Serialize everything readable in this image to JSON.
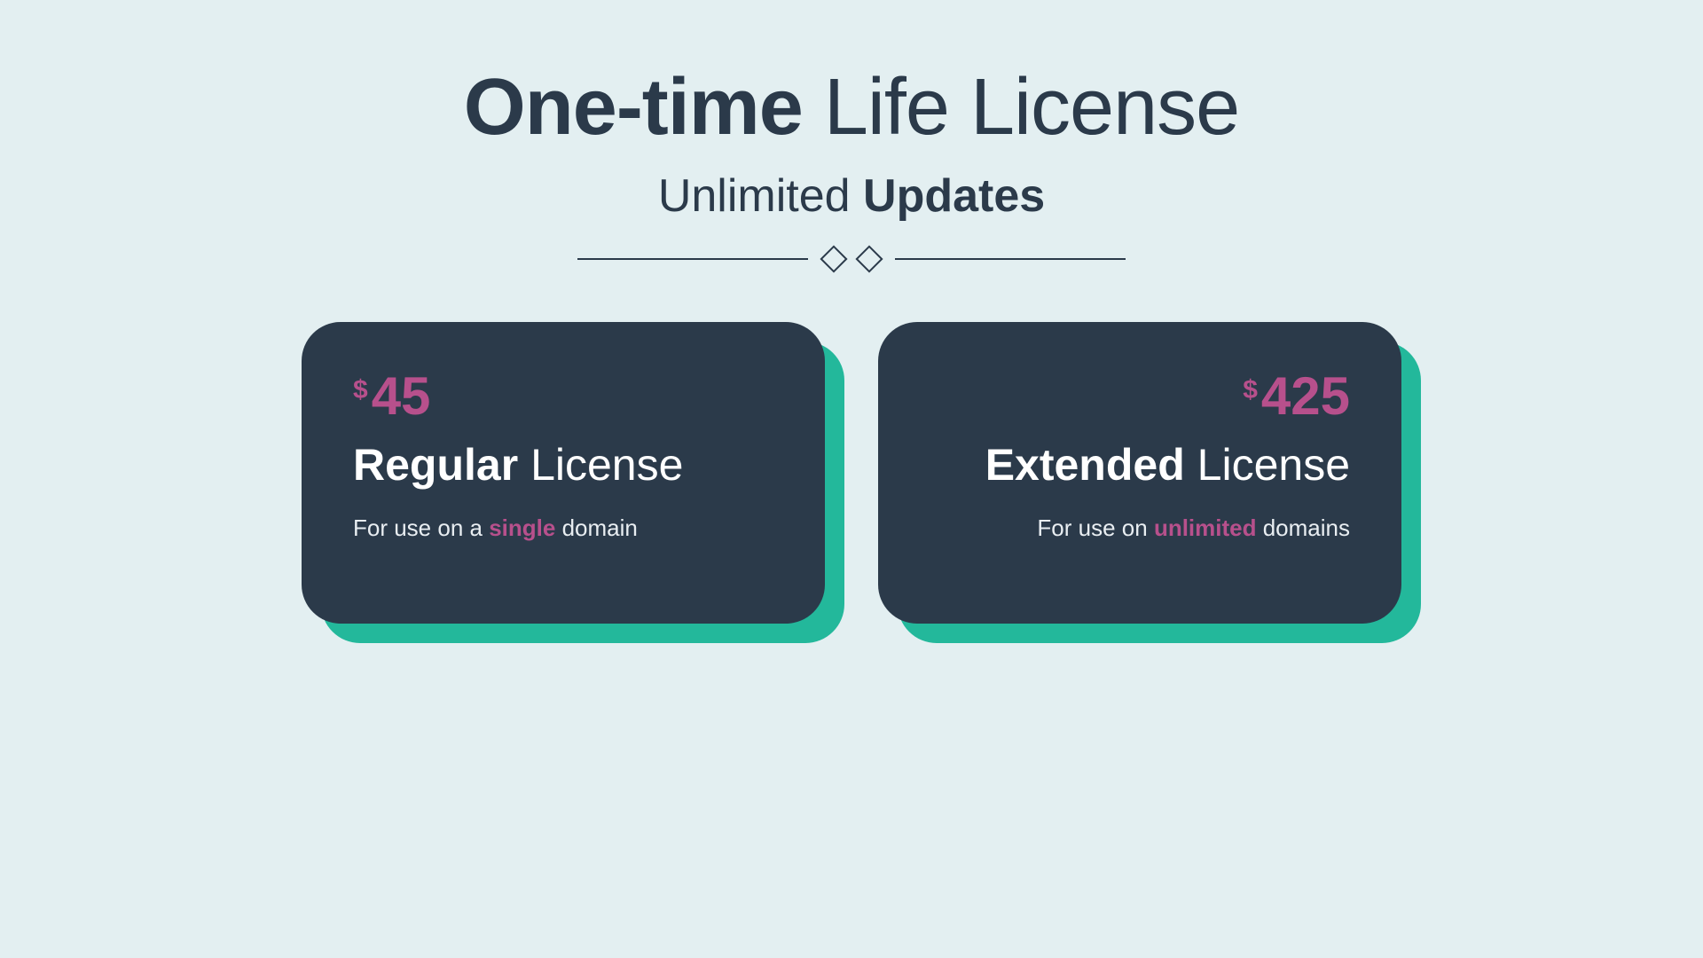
{
  "colors": {
    "background": "#e3eff1",
    "text_dark": "#2b3a4a",
    "card_bg": "#2b3a4a",
    "accent_teal": "#23b89b",
    "accent_pink": "#b7508c"
  },
  "headline": {
    "bold": "One-time",
    "light": "Life License"
  },
  "subhead": {
    "light": "Unlimited",
    "bold": "Updates"
  },
  "cards": [
    {
      "currency": "$",
      "price": "45",
      "title_bold": "Regular",
      "title_light": "License",
      "desc_pre": "For use on a ",
      "desc_hl": "single",
      "desc_post": " domain"
    },
    {
      "currency": "$",
      "price": "425",
      "title_bold": "Extended",
      "title_light": "License",
      "desc_pre": "For use on ",
      "desc_hl": "unlimited",
      "desc_post": " domains"
    }
  ]
}
